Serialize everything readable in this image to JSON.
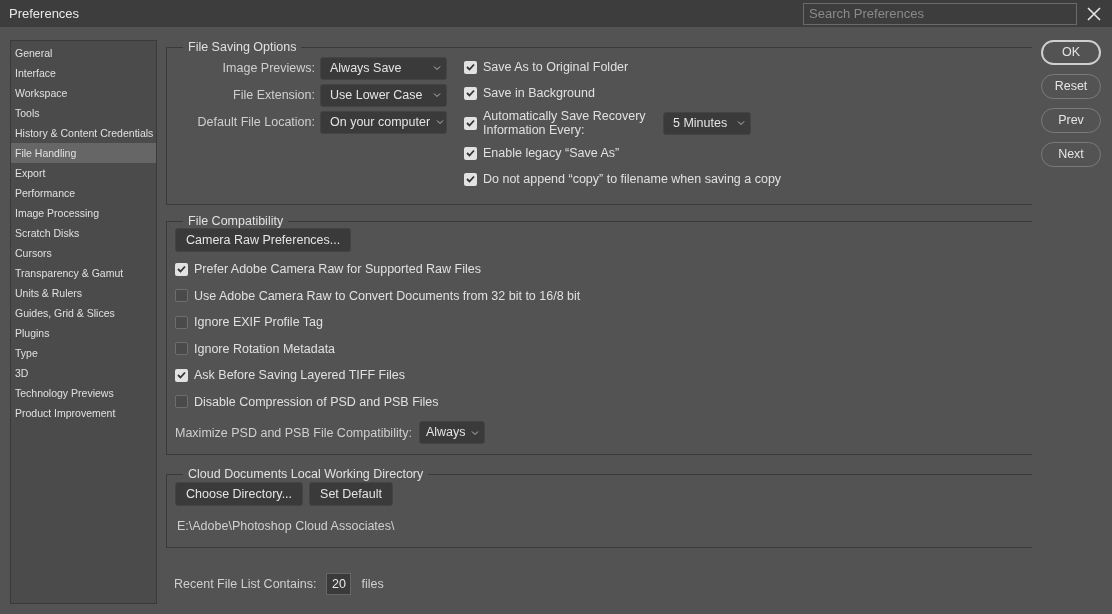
{
  "window": {
    "title": "Preferences"
  },
  "search": {
    "placeholder": "Search Preferences"
  },
  "sidebar": {
    "items": [
      {
        "label": "General",
        "selected": false
      },
      {
        "label": "Interface",
        "selected": false
      },
      {
        "label": "Workspace",
        "selected": false
      },
      {
        "label": "Tools",
        "selected": false
      },
      {
        "label": "History & Content Credentials",
        "selected": false
      },
      {
        "label": "File Handling",
        "selected": true
      },
      {
        "label": "Export",
        "selected": false
      },
      {
        "label": "Performance",
        "selected": false
      },
      {
        "label": "Image Processing",
        "selected": false
      },
      {
        "label": "Scratch Disks",
        "selected": false
      },
      {
        "label": "Cursors",
        "selected": false
      },
      {
        "label": "Transparency & Gamut",
        "selected": false
      },
      {
        "label": "Units & Rulers",
        "selected": false
      },
      {
        "label": "Guides, Grid & Slices",
        "selected": false
      },
      {
        "label": "Plugins",
        "selected": false
      },
      {
        "label": "Type",
        "selected": false
      },
      {
        "label": "3D",
        "selected": false
      },
      {
        "label": "Technology Previews",
        "selected": false
      },
      {
        "label": "Product Improvement",
        "selected": false
      }
    ]
  },
  "file_saving_options": {
    "title": "File Saving Options",
    "fields": [
      {
        "label": "Image Previews:",
        "value": "Always Save"
      },
      {
        "label": "File Extension:",
        "value": "Use Lower Case"
      },
      {
        "label": "Default File Location:",
        "value": "On your computer"
      }
    ],
    "checkboxes": [
      {
        "label": "Save As to Original Folder",
        "checked": true
      },
      {
        "label": "Save in Background",
        "checked": true
      },
      {
        "label": "Automatically Save Recovery Information Every:",
        "checked": true,
        "value": "5 Minutes"
      },
      {
        "label": "Enable legacy “Save As”",
        "checked": true
      },
      {
        "label": "Do not append “copy” to filename when saving a copy",
        "checked": true
      }
    ]
  },
  "file_compatibility": {
    "title": "File Compatibility",
    "button": "Camera Raw Preferences...",
    "checkboxes": [
      {
        "label": "Prefer Adobe Camera Raw for Supported Raw Files",
        "checked": true
      },
      {
        "label": "Use Adobe Camera Raw to Convert Documents from 32 bit to 16/8 bit",
        "checked": false
      },
      {
        "label": "Ignore EXIF Profile Tag",
        "checked": false
      },
      {
        "label": "Ignore Rotation Metadata",
        "checked": false
      },
      {
        "label": "Ask Before Saving Layered TIFF Files",
        "checked": true
      },
      {
        "label": "Disable Compression of PSD and PSB Files",
        "checked": false
      }
    ],
    "maximize": {
      "label": "Maximize PSD and PSB File Compatibility:",
      "value": "Always"
    }
  },
  "cloud_documents": {
    "title": "Cloud Documents Local Working Directory",
    "buttons": [
      "Choose Directory...",
      "Set Default"
    ],
    "path": "E:\\Adobe\\Photoshop Cloud Associates\\"
  },
  "recent_files": {
    "label": "Recent File List Contains:",
    "value": "20",
    "suffix": "files"
  },
  "buttons": [
    {
      "label": "OK",
      "default": true
    },
    {
      "label": "Reset",
      "default": false
    },
    {
      "label": "Prev",
      "default": false
    },
    {
      "label": "Next",
      "default": false
    }
  ]
}
